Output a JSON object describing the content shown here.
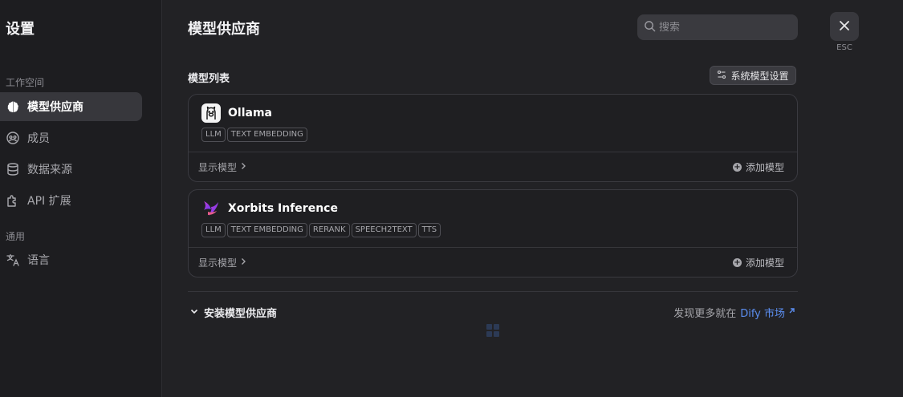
{
  "sidebar": {
    "title": "设置",
    "workspace_label": "工作空间",
    "general_label": "通用",
    "items": [
      {
        "label": "模型供应商",
        "icon": "brain-icon",
        "active": true
      },
      {
        "label": "成员",
        "icon": "members-icon",
        "active": false
      },
      {
        "label": "数据来源",
        "icon": "database-icon",
        "active": false
      },
      {
        "label": "API 扩展",
        "icon": "puzzle-icon",
        "active": false
      }
    ],
    "general_items": [
      {
        "label": "语言",
        "icon": "translate-icon"
      }
    ]
  },
  "header": {
    "title": "模型供应商",
    "search_placeholder": "搜索",
    "close_label": "ESC"
  },
  "model_list": {
    "title": "模型列表",
    "system_settings_label": "系统模型设置",
    "providers": [
      {
        "name": "Ollama",
        "tags": [
          "LLM",
          "TEXT EMBEDDING"
        ],
        "show_label": "显示模型",
        "add_label": "添加模型"
      },
      {
        "name": "Xorbits Inference",
        "tags": [
          "LLM",
          "TEXT EMBEDDING",
          "RERANK",
          "SPEECH2TEXT",
          "TTS"
        ],
        "show_label": "显示模型",
        "add_label": "添加模型"
      }
    ]
  },
  "install": {
    "title": "安装模型供应商",
    "discover_text": "发现更多就在",
    "marketplace_link": "Dify 市场"
  },
  "colors": {
    "background": "#222225",
    "sidebar": "#1d1d20",
    "active_item": "#37373c",
    "accent_link": "#5b8def"
  }
}
